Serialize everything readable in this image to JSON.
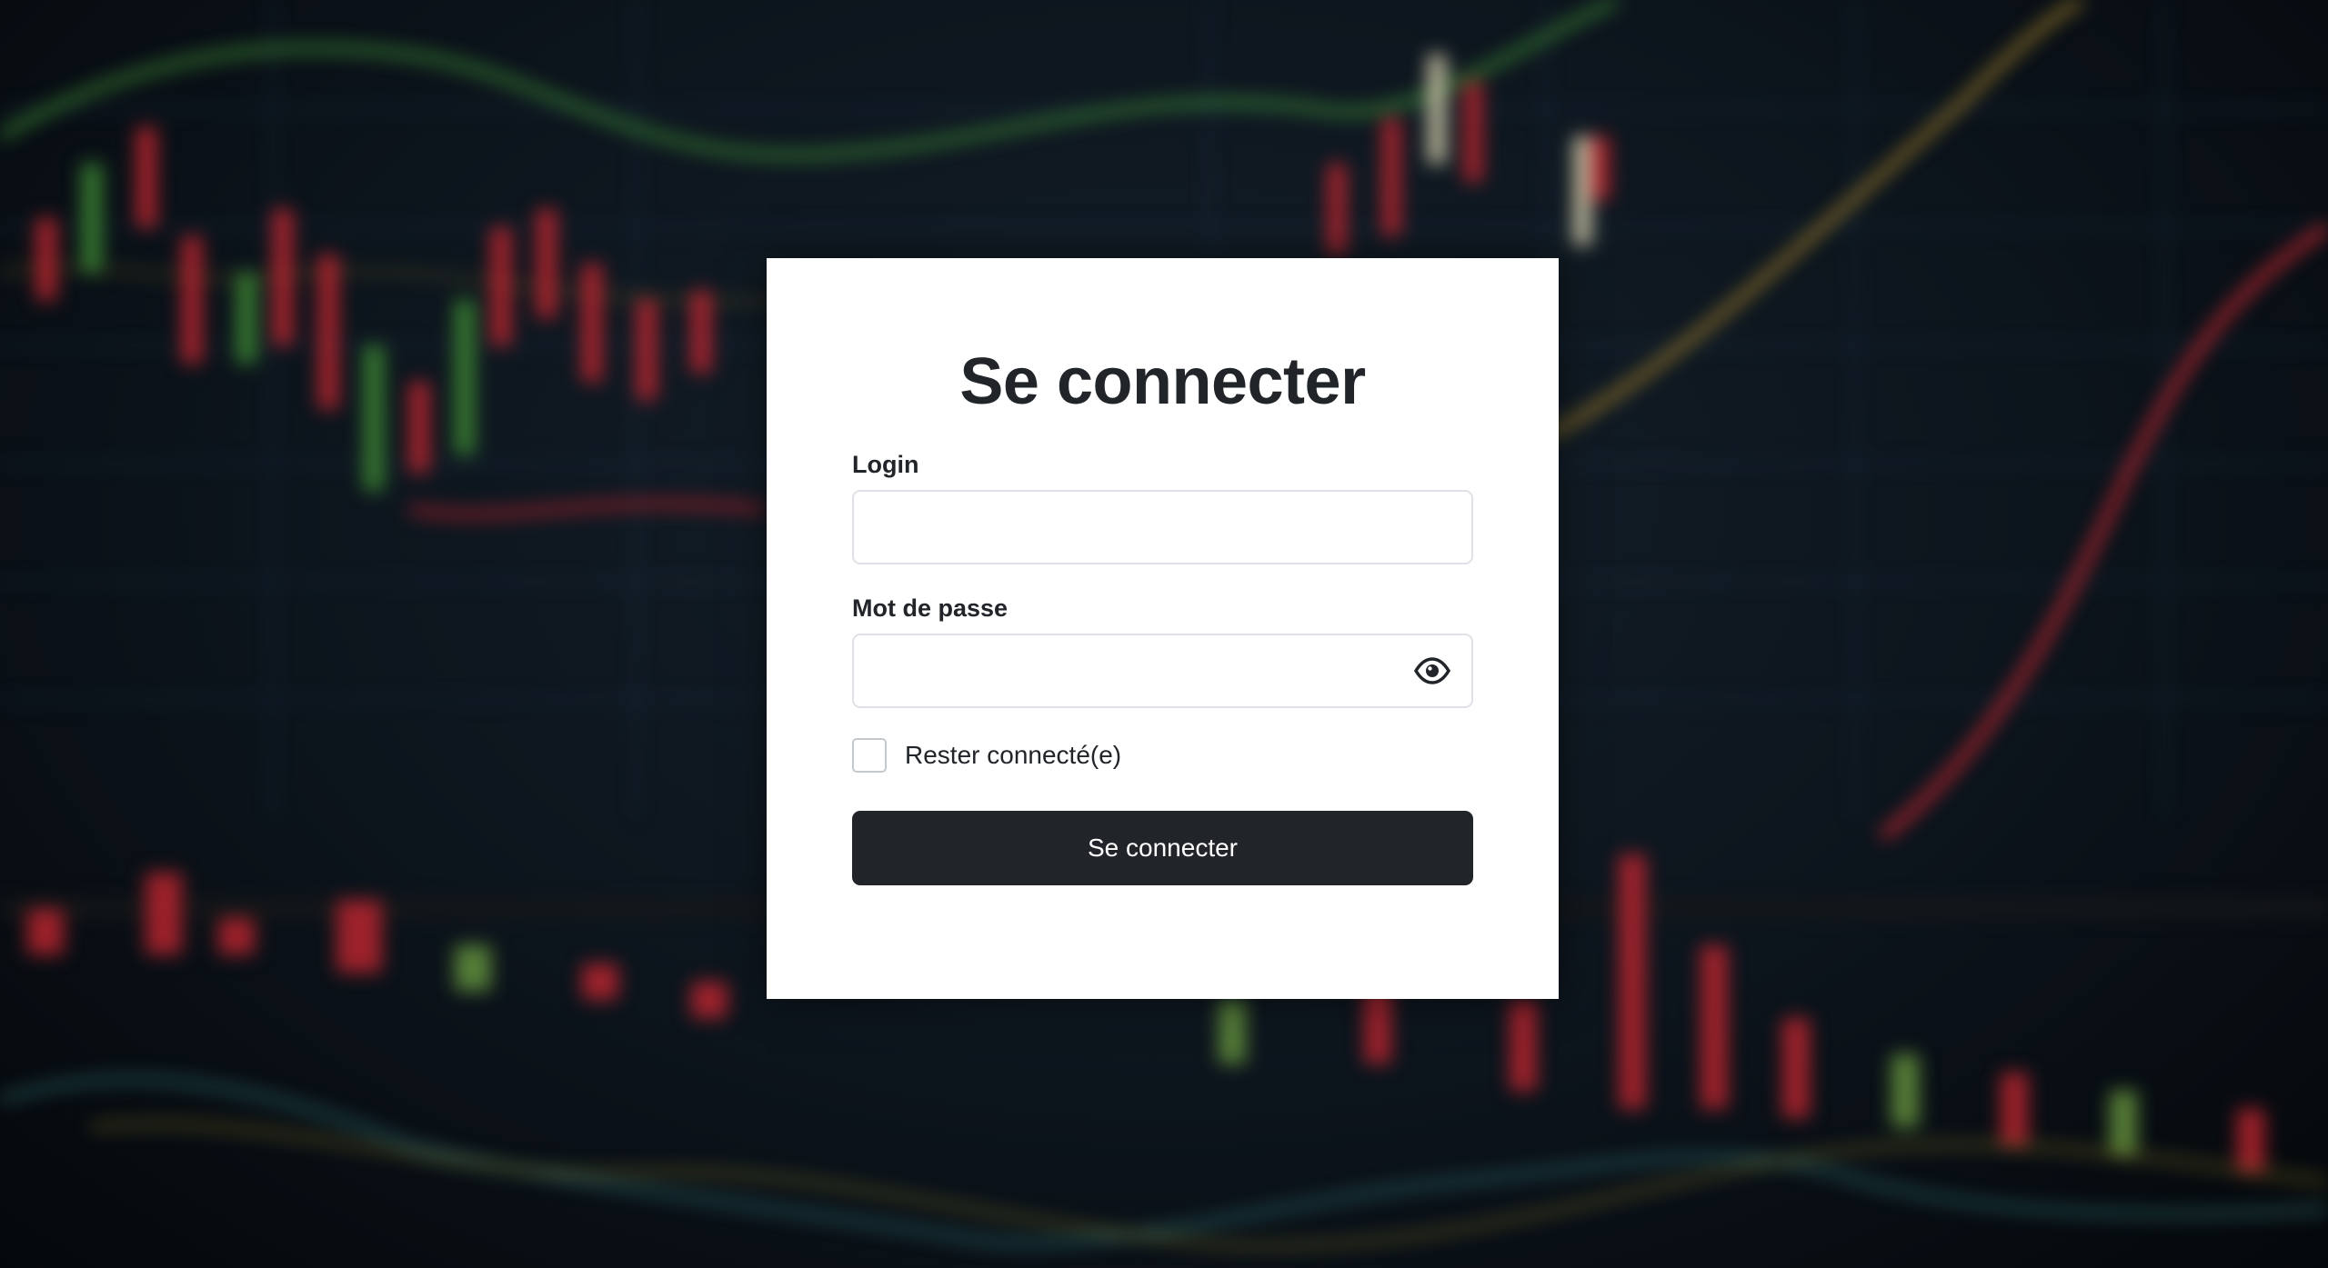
{
  "login_form": {
    "title": "Se connecter",
    "login_label": "Login",
    "login_value": "",
    "password_label": "Mot de passe",
    "password_value": "",
    "show_password_icon": "eye-icon",
    "remember_label": "Rester connecté(e)",
    "remember_checked": false,
    "submit_label": "Se connecter"
  },
  "background": {
    "description_icon": "blurred-stock-chart-background"
  },
  "colors": {
    "primary": "#212529",
    "card": "#ffffff",
    "border": "#dee2e6"
  }
}
